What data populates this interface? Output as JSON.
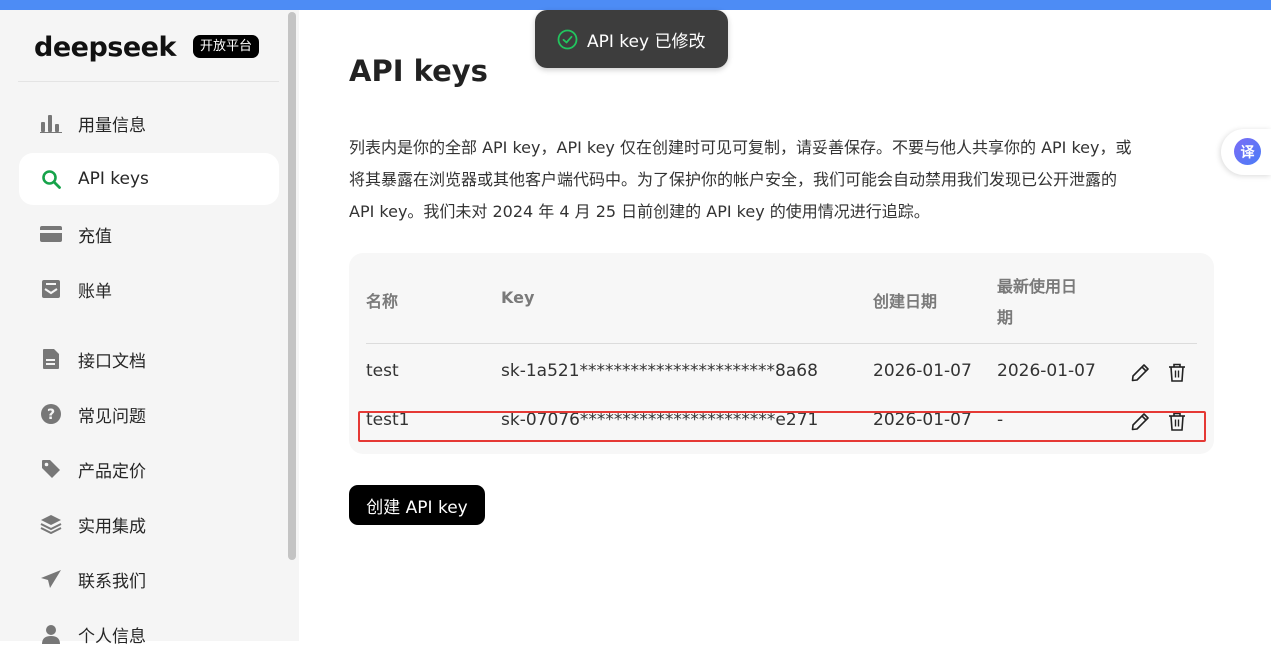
{
  "brand": {
    "logo": "deepseek",
    "badge": "开放平台"
  },
  "sidebar": {
    "items": [
      {
        "label": "用量信息",
        "icon": "bar-chart-icon",
        "active": false
      },
      {
        "label": "API keys",
        "icon": "search-icon",
        "active": true
      },
      {
        "label": "充值",
        "icon": "card-icon",
        "active": false
      },
      {
        "label": "账单",
        "icon": "invoice-icon",
        "active": false
      },
      {
        "label": "接口文档",
        "icon": "document-icon",
        "active": false
      },
      {
        "label": "常见问题",
        "icon": "question-icon",
        "active": false
      },
      {
        "label": "产品定价",
        "icon": "tag-icon",
        "active": false
      },
      {
        "label": "实用集成",
        "icon": "layers-icon",
        "active": false
      },
      {
        "label": "联系我们",
        "icon": "send-icon",
        "active": false
      },
      {
        "label": "个人信息",
        "icon": "user-icon",
        "active": false
      }
    ]
  },
  "main": {
    "title": "API keys",
    "description": [
      "列表内是你的全部 API key，API key 仅在创建时可见可复制，请妥善保存。不要与他人共享你的 API key，或",
      "将其暴露在浏览器或其他客户端代码中。为了保护你的帐户安全，我们可能会自动禁用我们发现已公开泄露的",
      "API key。我们未对 2024 年 4 月 25 日前创建的 API key 的使用情况进行追踪。"
    ],
    "table": {
      "headers": {
        "name": "名称",
        "key": "Key",
        "created": "创建日期",
        "last_used_line1": "最新使用日",
        "last_used_line2": "期"
      },
      "rows": [
        {
          "name": "test",
          "key": "sk-1a521***********************8a68",
          "created": "2026-01-07",
          "last_used": "2026-01-07"
        },
        {
          "name": "test1",
          "key": "sk-07076***********************e271",
          "created": "2026-01-07",
          "last_used": "-"
        }
      ]
    },
    "create_button": "创建 API key"
  },
  "toast": {
    "message": "API key 已修改",
    "color": "#22c55e"
  },
  "translate": {
    "label": "译"
  },
  "colors": {
    "accent": "#4d8cf5",
    "active_icon": "#16a34a",
    "highlight": "#e53935"
  }
}
